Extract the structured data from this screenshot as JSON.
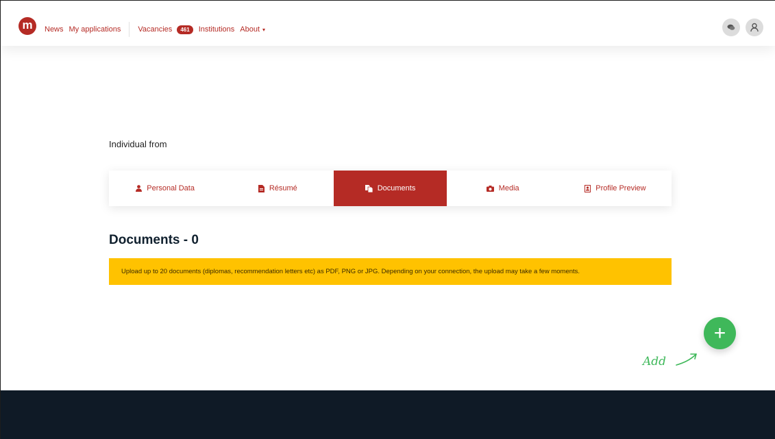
{
  "header": {
    "logo_letter": "m",
    "nav": {
      "news": "News",
      "my_applications": "My applications",
      "vacancies": "Vacancies",
      "vacancies_count": "461",
      "institutions": "Institutions",
      "about": "About"
    },
    "icons": [
      "chat-icon",
      "user-icon"
    ]
  },
  "profile": {
    "intro": "Individual from"
  },
  "tabs": [
    {
      "label": "Personal Data",
      "icon": "person-icon",
      "active": false
    },
    {
      "label": "Résumé",
      "icon": "file-icon",
      "active": false
    },
    {
      "label": "Documents",
      "icon": "documents-icon",
      "active": true
    },
    {
      "label": "Media",
      "icon": "camera-icon",
      "active": false
    },
    {
      "label": "Profile Preview",
      "icon": "profile-card-icon",
      "active": false
    }
  ],
  "documents": {
    "title": "Documents - 0",
    "notice": "Upload up to 20 documents (diplomas, recommendation letters etc) as PDF, PNG or JPG. Depending on your connection, the upload may take a few moments."
  },
  "add": {
    "button_symbol": "+",
    "hint": "Add"
  },
  "colors": {
    "brand": "#b52b25",
    "notice": "#ffc200",
    "add": "#3fb85a",
    "footer": "#0f1a26"
  }
}
